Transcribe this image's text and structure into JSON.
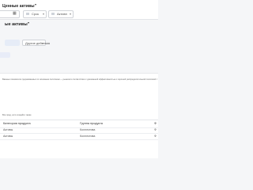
{
  "toolbar": {
    "title": "Ценные активы\"",
    "filters": [
      {
        "label": "Срок",
        "icon": "flag-icon"
      },
      {
        "label": "Активн",
        "icon": "flag-icon"
      }
    ],
    "date_icon": "calendar-icon"
  },
  "page": {
    "title": "ые активы\""
  },
  "tabs": [
    {
      "label": "",
      "active": true
    },
    {
      "label": "Другие действия",
      "active": false
    }
  ],
  "description": {
    "text": "Важные показатели сдерживаемых по основным политикам — рынком в соответствии с доказанной эффективностью и хорошей распределительной политикой. Подробнее о соответствии документации по тестированию."
  },
  "table": {
    "caption": "Все пред, кого создайте также",
    "headers": [
      "Категория продукта",
      "Группа продукта",
      "Ф"
    ],
    "rows": [
      [
        "Активы",
        "Коллектива",
        "Ф"
      ],
      [
        "Активы",
        "Коллектива",
        "Ф"
      ]
    ]
  },
  "colors": {
    "accent": "#2a4a8a",
    "tab_active_bg": "#e6ecf7"
  }
}
